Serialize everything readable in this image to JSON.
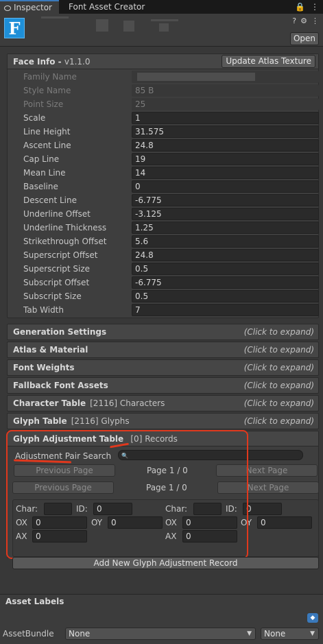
{
  "tabs": {
    "inspector": "Inspector",
    "font_creator": "Font Asset Creator"
  },
  "window_tools": {
    "lock": "🔒",
    "menu": "⋮"
  },
  "header": {
    "logo_letter": "F",
    "help": "?",
    "settings": "⚙",
    "more": "⋮",
    "open_button": "Open"
  },
  "face_info": {
    "title": "Face Info - ",
    "version": "v1.1.0",
    "update_button": "Update Atlas Texture",
    "rows": [
      {
        "label": "Family Name",
        "value": "",
        "disabled": true
      },
      {
        "label": "Style Name",
        "value": "85 B",
        "disabled": true
      },
      {
        "label": "Point Size",
        "value": "25",
        "disabled": true
      },
      {
        "label": "Scale",
        "value": "1",
        "disabled": false
      },
      {
        "label": "Line Height",
        "value": "31.575",
        "disabled": false
      },
      {
        "label": "Ascent Line",
        "value": "24.8",
        "disabled": false
      },
      {
        "label": "Cap Line",
        "value": "19",
        "disabled": false
      },
      {
        "label": "Mean Line",
        "value": "14",
        "disabled": false
      },
      {
        "label": "Baseline",
        "value": "0",
        "disabled": false
      },
      {
        "label": "Descent Line",
        "value": "-6.775",
        "disabled": false
      },
      {
        "label": "Underline Offset",
        "value": "-3.125",
        "disabled": false
      },
      {
        "label": "Underline Thickness",
        "value": "1.25",
        "disabled": false
      },
      {
        "label": "Strikethrough Offset",
        "value": "5.6",
        "disabled": false
      },
      {
        "label": "Superscript Offset",
        "value": "24.8",
        "disabled": false
      },
      {
        "label": "Superscript Size",
        "value": "0.5",
        "disabled": false
      },
      {
        "label": "Subscript Offset",
        "value": "-6.775",
        "disabled": false
      },
      {
        "label": "Subscript Size",
        "value": "0.5",
        "disabled": false
      },
      {
        "label": "Tab Width",
        "value": "7",
        "disabled": false
      }
    ]
  },
  "collapsed_sections": [
    {
      "label": "Generation Settings",
      "sub": ""
    },
    {
      "label": "Atlas & Material",
      "sub": ""
    },
    {
      "label": "Font Weights",
      "sub": ""
    },
    {
      "label": "Fallback Font Assets",
      "sub": ""
    },
    {
      "label": "Character Table",
      "sub": "[2116] Characters"
    },
    {
      "label": "Glyph Table",
      "sub": "[2116] Glyphs"
    }
  ],
  "expand_hint": "(Click to expand)",
  "glyph_adjustment": {
    "title": "Glyph Adjustment Table",
    "records": "[0] Records",
    "search_label": "Adjustment Pair Search",
    "search_icon": "🔍",
    "search_value": "",
    "prev_page": "Previous Page",
    "next_page": "Next Page",
    "page_indicator": "Page 1 / 0",
    "char_label": "Char:",
    "id_label": "ID:",
    "ox_label": "OX",
    "oy_label": "OY",
    "ax_label": "AX",
    "left": {
      "id": "0",
      "ox": "0",
      "oy": "0",
      "ax": "0"
    },
    "right": {
      "id": "0",
      "ox": "0",
      "oy": "0",
      "ax": "0"
    },
    "add_button": "Add New Glyph Adjustment Record"
  },
  "asset_labels": {
    "title": "Asset Labels",
    "label_icon": "tag-icon",
    "bundle_label": "AssetBundle",
    "bundle_value": "None",
    "variant_value": "None"
  },
  "colors": {
    "accent": "#3a79bb",
    "annotation": "#e0381d",
    "logo": "#1e8fd8"
  }
}
